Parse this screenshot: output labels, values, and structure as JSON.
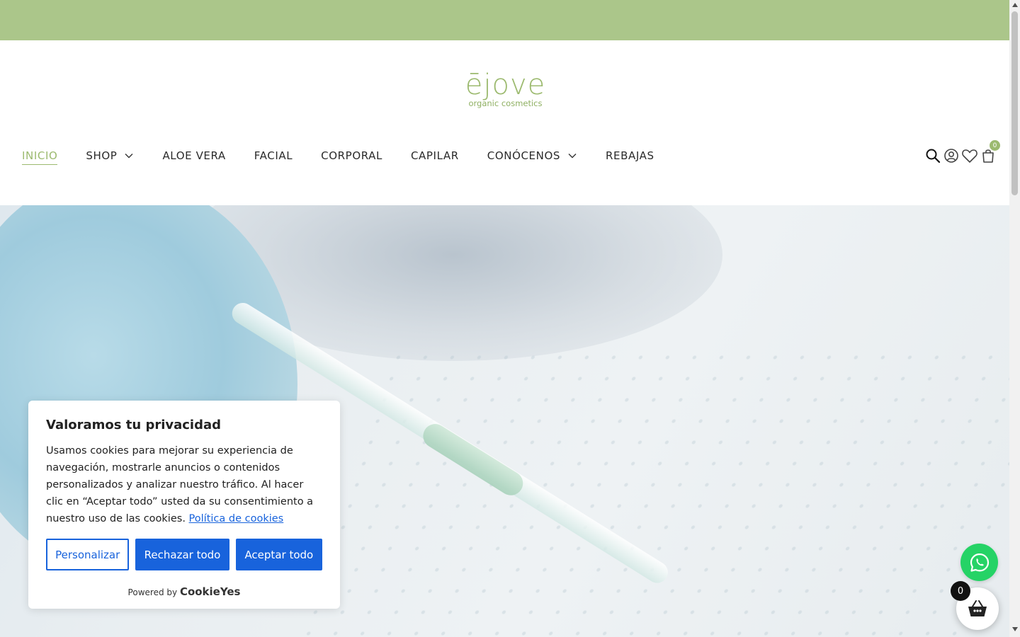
{
  "brand": {
    "logo_main": "ējove",
    "logo_tagline": "organic cosmetics",
    "accent_color": "#abc68a"
  },
  "nav": {
    "items": [
      {
        "label": "INICIO",
        "active": true,
        "has_dropdown": false
      },
      {
        "label": "SHOP",
        "active": false,
        "has_dropdown": true
      },
      {
        "label": "ALOE VERA",
        "active": false,
        "has_dropdown": false
      },
      {
        "label": "FACIAL",
        "active": false,
        "has_dropdown": false
      },
      {
        "label": "CORPORAL",
        "active": false,
        "has_dropdown": false
      },
      {
        "label": "CAPILAR",
        "active": false,
        "has_dropdown": false
      },
      {
        "label": "CONÓCENOS",
        "active": false,
        "has_dropdown": true
      },
      {
        "label": "REBAJAS",
        "active": false,
        "has_dropdown": false
      }
    ]
  },
  "header_icons": {
    "icons": [
      "search-icon",
      "account-icon",
      "wishlist-icon",
      "cart-icon"
    ],
    "cart_count": "0"
  },
  "cookie_banner": {
    "title": "Valoramos tu privacidad",
    "text": "Usamos cookies para mejorar su experiencia de navegación, mostrarle anuncios o contenidos personalizados y analizar nuestro tráfico. Al hacer clic en “Aceptar todo” usted da su consentimiento a nuestro uso de las cookies.",
    "policy_link": "Política de cookies",
    "btn_customize": "Personalizar",
    "btn_reject": "Rechazar todo",
    "btn_accept": "Aceptar todo",
    "powered_by": "Powered by",
    "powered_brand": "CookieYes",
    "button_color": "#1863dc"
  },
  "floating": {
    "whatsapp_icon": "whatsapp-icon",
    "whatsapp_color": "#25d366",
    "cart_count": "0"
  }
}
